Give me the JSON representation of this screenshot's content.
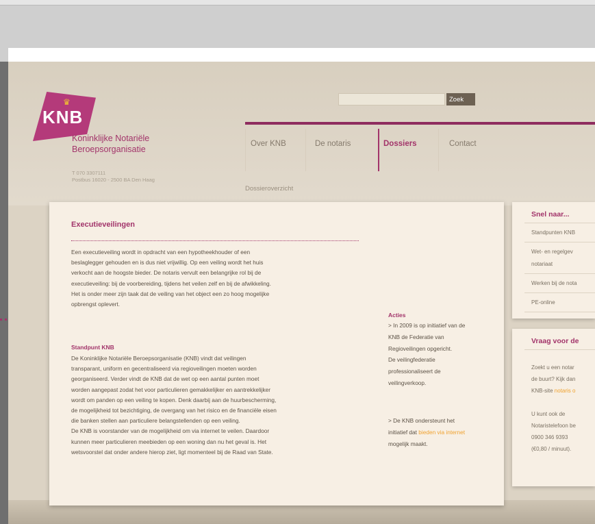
{
  "header": {
    "logo_text": "KNB",
    "org_name_line1": "Koninklijke Notariële",
    "org_name_line2": "Beroepsorganisatie",
    "phone": "T 070 3307111",
    "address": "Postbus 16020 - 2500 BA Den Haag",
    "search_placeholder": "",
    "search_button": "Zoek"
  },
  "nav": {
    "items": [
      {
        "label": "Over KNB"
      },
      {
        "label": "De notaris"
      },
      {
        "label": "Dossiers"
      },
      {
        "label": "Contact"
      }
    ],
    "sub_item": "Dossieroverzicht"
  },
  "article": {
    "title": "Executieveilingen",
    "intro": [
      "Een executieveiling wordt in opdracht van een hypotheekhouder of een",
      "beslaglegger gehouden en is dus niet vrijwillig. Op een veiling wordt het huis",
      "verkocht aan de hoogste bieder. De notaris vervult een belangrijke rol bij de",
      "executieveiling: bij de voorbereiding, tijdens het veilen zelf en bij de afwikkeling.",
      "Het is onder meer zijn taak dat de veiling van het object een zo hoog mogelijke",
      "opbrengst oplevert."
    ],
    "standpunt_title": "Standpunt KNB",
    "standpunt": [
      "De Koninklijke Notariële Beroepsorganisatie (KNB) vindt dat veilingen",
      "transparant, uniform en gecentraliseerd via regioveilingen moeten worden",
      "georganiseerd. Verder vindt de KNB dat de wet op een aantal punten moet",
      "worden aangepast zodat het voor particulieren gemakkelijker en aantrekkelijker",
      "wordt om panden op een veiling te kopen. Denk daarbij aan de huurbescherming,",
      "de mogelijkheid tot bezichtiging, de overgang van het risico en de financiële eisen",
      "die banken stellen aan particuliere belangstellenden op een veiling.",
      "De KNB is voorstander van de mogelijkheid om via internet te veilen. Daardoor",
      "kunnen meer particulieren meebieden op een woning dan nu het geval is. Het",
      "wetsvoorstel dat onder andere hierop ziet, ligt momenteel bij de Raad van State."
    ]
  },
  "acties": {
    "title": "Acties",
    "block1": [
      "> In 2009 is op initiatief van de",
      "KNB de Federatie van",
      "Regioveilingen opgericht.",
      "De veilingfederatie",
      "professionaliseert de",
      "veilingverkoop."
    ],
    "block2_line1": "> De KNB ondersteunt het",
    "block2_pre": "initiatief dat ",
    "block2_link": "bieden via internet",
    "block2_line3": "mogelijk maakt."
  },
  "sidebar1": {
    "title": "Snel naar...",
    "items": [
      "Standpunten KNB",
      "Wet- en regelgev",
      "notariaat",
      "Werken bij de nota",
      "PE-online"
    ]
  },
  "sidebar2": {
    "title": "Vraag voor de",
    "lines": [
      "Zoekt u een notar",
      "de buurt? Kijk dan",
      "KNB-site "
    ],
    "link": "notaris o",
    "lines2": [
      "U kunt ook de",
      "Notaristelefoon be",
      "0900 346 9393",
      "(€0,80 / minuut)."
    ]
  },
  "colors": {
    "brand": "#a2346a",
    "accent": "#f0a22f",
    "nav_line": "#8e2c5f"
  }
}
